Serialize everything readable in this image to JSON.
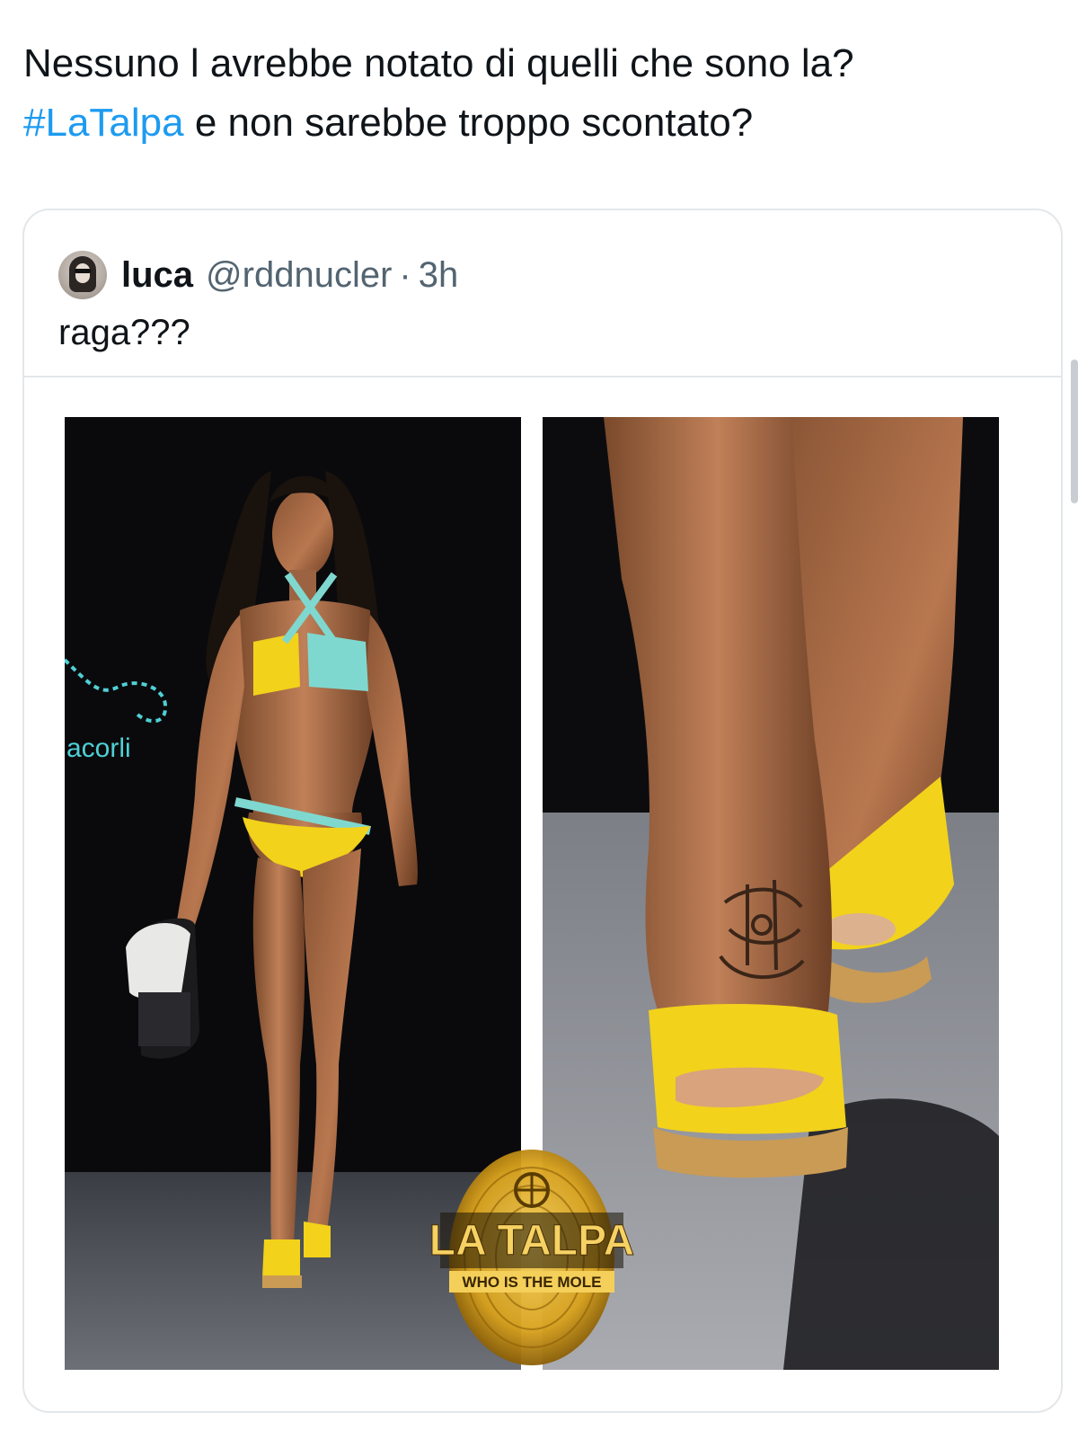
{
  "tweet": {
    "text_line1": "Nessuno l avrebbe notato di quelli che sono la?",
    "hashtag": "#LaTalpa",
    "text_line2_rest": " e non sarebbe troppo scontato?"
  },
  "quoted_tweet": {
    "display_name": "luca",
    "handle": "@rddnucler",
    "separator": "·",
    "time": "3h",
    "text": "raga???",
    "media": {
      "left_image": {
        "description_icon": "runway-model-photo",
        "backdrop_text": "acorli"
      },
      "right_image": {
        "description_icon": "foot-tattoo-closeup-photo"
      },
      "logo": {
        "title": "LA TALPA",
        "subtitle": "WHO IS THE MOLE"
      }
    }
  },
  "colors": {
    "text": "#0f1419",
    "secondary": "#536471",
    "link": "#1d9bf0",
    "border": "#e3e7ea",
    "bikini_yellow": "#f2d21b",
    "bikini_aqua": "#7fd8cf",
    "logo_gold": "#d9a21c"
  }
}
